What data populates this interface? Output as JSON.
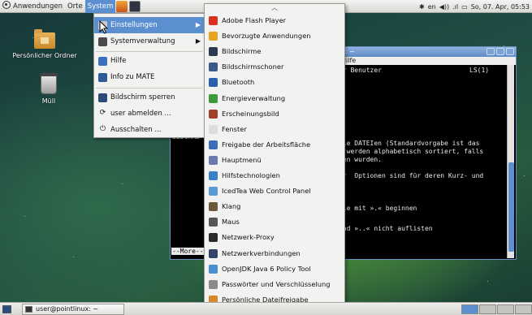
{
  "top_panel": {
    "applications_label": "Anwendungen",
    "places_label": "Orte",
    "system_label": "System",
    "tray": {
      "keyboard_layout": "en",
      "clock": "So, 07. Apr, 05:53"
    }
  },
  "desktop": {
    "icons": [
      {
        "label": "Persönlicher Ordner"
      },
      {
        "label": "Müll"
      }
    ]
  },
  "system_menu": {
    "items": [
      {
        "label": "Einstellungen",
        "has_submenu": true,
        "icon": "settings-icon"
      },
      {
        "label": "Systemverwaltung",
        "has_submenu": true,
        "icon": "admin-icon"
      },
      {
        "label": "Hilfe",
        "icon": "help-icon"
      },
      {
        "label": "Info zu MATE",
        "icon": "info-icon"
      },
      {
        "label": "Bildschirm sperren",
        "icon": "lock-screen-icon"
      },
      {
        "label": "user abmelden ...",
        "icon": "logout-icon"
      },
      {
        "label": "Ausschalten ...",
        "icon": "power-icon"
      }
    ]
  },
  "settings_menu": {
    "items": [
      {
        "label": "Adobe Flash Player",
        "icon": "flash-icon",
        "color": "#d8321e"
      },
      {
        "label": "Bevorzugte Anwendungen",
        "icon": "preferred-apps-icon",
        "color": "#e5a321"
      },
      {
        "label": "Bildschirme",
        "icon": "monitor-icon",
        "color": "#2d3b52"
      },
      {
        "label": "Bildschirmschoner",
        "icon": "screensaver-icon",
        "color": "#3c5a8a"
      },
      {
        "label": "Bluetooth",
        "icon": "bluetooth-icon",
        "color": "#2a5fb0"
      },
      {
        "label": "Energieverwaltung",
        "icon": "power-manager-icon",
        "color": "#3f9a3a"
      },
      {
        "label": "Erscheinungsbild",
        "icon": "appearance-icon",
        "color": "#a0402a"
      },
      {
        "label": "Fenster",
        "icon": "window-icon",
        "color": "#dcdcdc"
      },
      {
        "label": "Freigabe der Arbeitsfläche",
        "icon": "desktop-sharing-icon",
        "color": "#3a6fb5"
      },
      {
        "label": "Hauptmenü",
        "icon": "main-menu-icon",
        "color": "#6a7ab0"
      },
      {
        "label": "Hilfstechnologien",
        "icon": "accessibility-icon",
        "color": "#3a82c8"
      },
      {
        "label": "IcedTea Web Control Panel",
        "icon": "java-icon",
        "color": "#5a9ad6"
      },
      {
        "label": "Klang",
        "icon": "sound-icon",
        "color": "#6a5a3a"
      },
      {
        "label": "Maus",
        "icon": "mouse-icon",
        "color": "#555555"
      },
      {
        "label": "Netzwerk-Proxy",
        "icon": "network-proxy-icon",
        "color": "#2a2a2a"
      },
      {
        "label": "Netzwerkverbindungen",
        "icon": "network-connections-icon",
        "color": "#334466"
      },
      {
        "label": "OpenJDK Java 6 Policy Tool",
        "icon": "java-policy-icon",
        "color": "#4a90d0"
      },
      {
        "label": "Passwörter und Verschlüsselung",
        "icon": "passwords-icon",
        "color": "#8a8a8a"
      },
      {
        "label": "Persönliche Dateifreigabe",
        "icon": "file-sharing-icon",
        "color": "#d88a2a"
      }
    ]
  },
  "terminal": {
    "title_suffix": "nux: ~",
    "menu_help": "Hilfe",
    "lines": [
      {
        "text": "ür Benutzer",
        "right": "LS(1)"
      },
      {
        "text": "die DATEIen (Standardvorgabe ist das"
      },
      {
        "text": "e werden alphabetisch sortiert, falls"
      },
      {
        "text": "ben wurden."
      },
      {
        "text": "ür  Optionen sind für deren Kurz- und"
      },
      {
        "text": "die mit ».« beginnen"
      },
      {
        "text": "und »..« nicht auflisten"
      }
    ],
    "left_fragment": "BESCHRE",
    "more_prompt": "--More--"
  },
  "taskbar": {
    "task_label": "user@pointlinux: ~"
  }
}
